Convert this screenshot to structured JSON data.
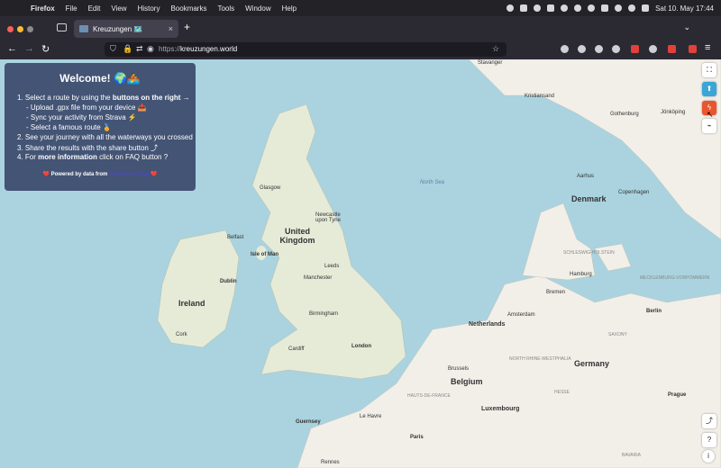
{
  "menubar": {
    "app": "Firefox",
    "items": [
      "File",
      "Edit",
      "View",
      "History",
      "Bookmarks",
      "Tools",
      "Window",
      "Help"
    ],
    "datetime": "Sat 10. May  17:44"
  },
  "tab": {
    "title": "Kreuzungen 🗺️",
    "close": "×",
    "new": "+"
  },
  "urlbar": {
    "scheme": "https://",
    "host": "kreuzungen.world"
  },
  "welcome": {
    "title": "Welcome! 🌍🚣",
    "step1_prefix": "1. Select a route by using the ",
    "step1_bold": "buttons on the right",
    "step1_suffix": " →",
    "sub1": "- Upload .gpx file from your device 📤",
    "sub2": "- Sync your activity from Strava ⚡",
    "sub3": "- Select a famous route 🏅",
    "step2": "2. See your journey with all the waterways you crossed",
    "step3": "3. Share the results with the share button ⤴",
    "step4_prefix": "4. For ",
    "step4_bold": "more information",
    "step4_suffix": " click on FAQ button ?",
    "powered_prefix": "❤️ Powered by data from ",
    "powered_link": "OpenStreetMap",
    "powered_suffix": " ❤️"
  },
  "map": {
    "countries": [
      "United Kingdom",
      "Ireland",
      "Denmark",
      "Netherlands",
      "Belgium",
      "Germany",
      "Luxembourg"
    ],
    "cities": [
      "Glasgow",
      "Belfast",
      "Isle of Man",
      "Dublin",
      "Cork",
      "Leeds",
      "Manchester",
      "Birmingham",
      "Cardiff",
      "London",
      "Guernsey",
      "Le Havre",
      "Paris",
      "Rennes",
      "Brussels",
      "Amsterdam",
      "Bremen",
      "Hamburg",
      "Berlin",
      "Copenhagen",
      "Aarhus",
      "Gothenburg",
      "Stavanger",
      "Kristiansand",
      "Jönköping",
      "Newcastle upon Tyne",
      "Prague"
    ],
    "sea": "North Sea",
    "region_labels": [
      "SCHLESWIG-HOLSTEIN",
      "MECKLENBURG-VORPOMMERN",
      "NORTH RHINE-WESTPHALIA",
      "HAUTS-DE-FRANCE",
      "SAXONY",
      "HESSE",
      "BAVARIA"
    ]
  },
  "buttons": {
    "fullscreen": "⛶",
    "upload": "⬆",
    "strava": "ϟ",
    "route": "⌁",
    "share": "⤴",
    "faq": "?",
    "info": "i"
  }
}
